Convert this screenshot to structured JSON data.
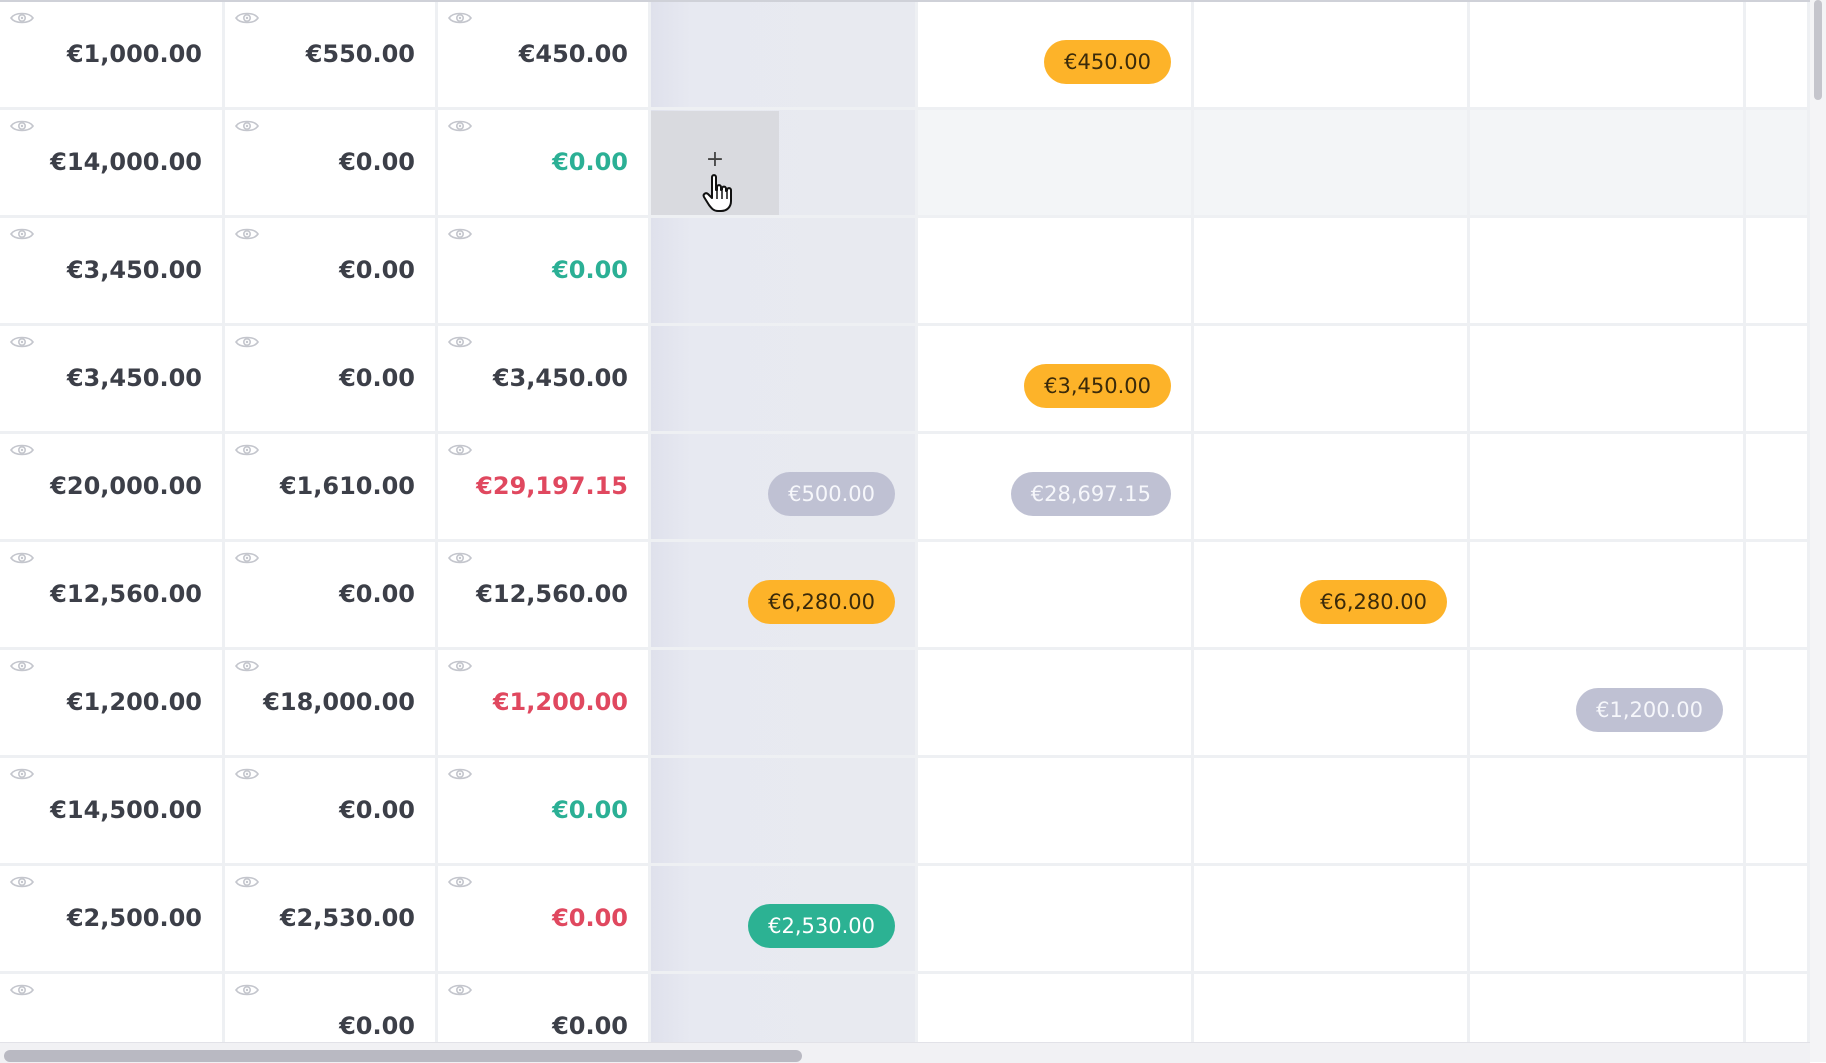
{
  "rows": [
    {
      "c1": "€1,000.00",
      "c2": "€550.00",
      "c3": "€450.00",
      "c3_status": "neutral",
      "pills": [
        {
          "col": 2,
          "label": "€450.00",
          "style": "orange"
        }
      ]
    },
    {
      "c1": "€14,000.00",
      "c2": "€0.00",
      "c3": "€0.00",
      "c3_status": "green",
      "pills": []
    },
    {
      "c1": "€3,450.00",
      "c2": "€0.00",
      "c3": "€0.00",
      "c3_status": "green",
      "pills": []
    },
    {
      "c1": "€3,450.00",
      "c2": "€0.00",
      "c3": "€3,450.00",
      "c3_status": "neutral",
      "pills": [
        {
          "col": 2,
          "label": "€3,450.00",
          "style": "orange"
        }
      ]
    },
    {
      "c1": "€20,000.00",
      "c2": "€1,610.00",
      "c3": "€29,197.15",
      "c3_status": "red",
      "pills": [
        {
          "col": 1,
          "label": "€500.00",
          "style": "grey"
        },
        {
          "col": 2,
          "label": "€28,697.15",
          "style": "grey"
        }
      ]
    },
    {
      "c1": "€12,560.00",
      "c2": "€0.00",
      "c3": "€12,560.00",
      "c3_status": "neutral",
      "pills": [
        {
          "col": 1,
          "label": "€6,280.00",
          "style": "orange"
        },
        {
          "col": 3,
          "label": "€6,280.00",
          "style": "orange"
        }
      ]
    },
    {
      "c1": "€1,200.00",
      "c2": "€18,000.00",
      "c3": "€1,200.00",
      "c3_status": "red",
      "pills": [
        {
          "col": 4,
          "label": "€1,200.00",
          "style": "grey"
        }
      ]
    },
    {
      "c1": "€14,500.00",
      "c2": "€0.00",
      "c3": "€0.00",
      "c3_status": "green",
      "pills": []
    },
    {
      "c1": "€2,500.00",
      "c2": "€2,530.00",
      "c3": "€0.00",
      "c3_status": "red",
      "pills": [
        {
          "col": 1,
          "label": "€2,530.00",
          "style": "green"
        }
      ]
    },
    {
      "c1": "",
      "c2": "€0.00",
      "c3": "€0.00",
      "c3_status": "neutral",
      "pills": []
    }
  ],
  "hover_row": 1,
  "add_slot": {
    "label": "+"
  },
  "icons": {
    "row_view": "eye-icon",
    "cursor": "hand-pointer-icon"
  },
  "colors": {
    "orange": "#fdb329",
    "grey": "#bfc1d3",
    "green": "#2cb293",
    "red": "#e0485f",
    "green_text": "#2bb095"
  }
}
